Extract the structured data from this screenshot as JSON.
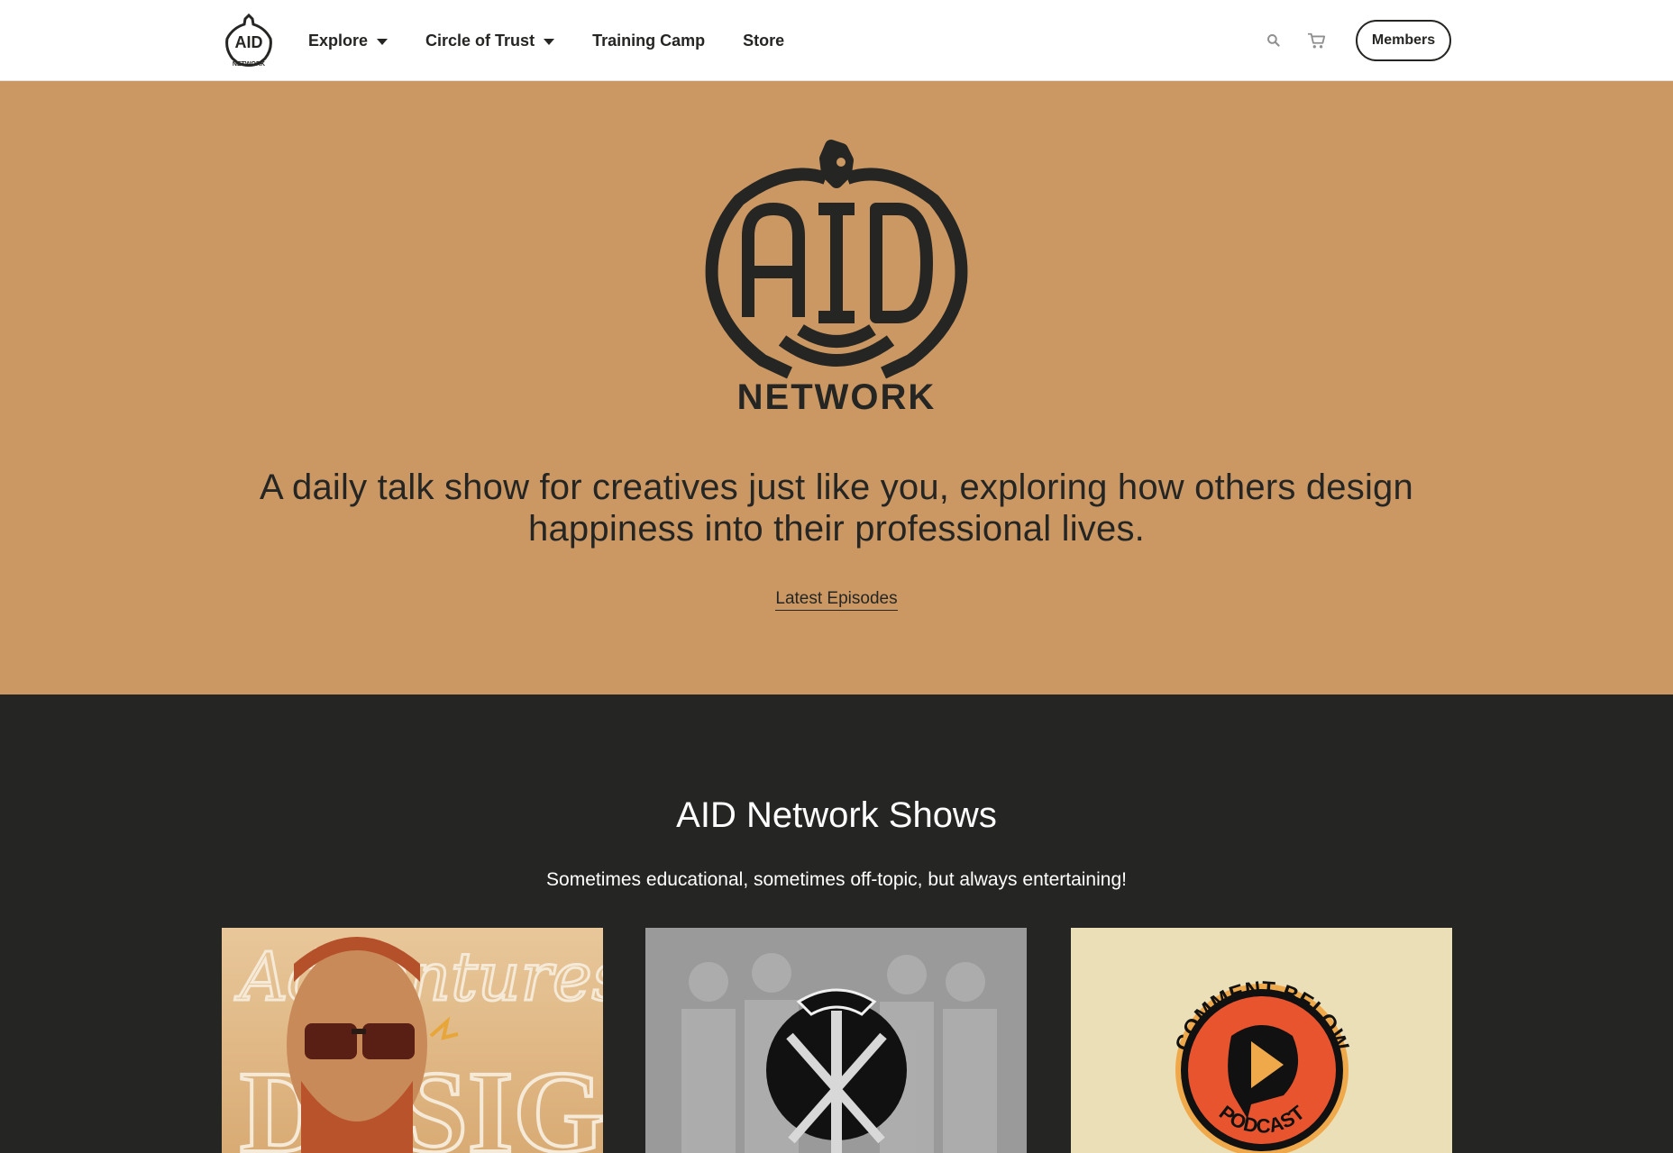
{
  "nav": {
    "logo_text": "AID NETWORK",
    "links": [
      {
        "label": "Explore",
        "has_dropdown": true
      },
      {
        "label": "Circle of Trust",
        "has_dropdown": true
      },
      {
        "label": "Training Camp",
        "has_dropdown": false
      },
      {
        "label": "Store",
        "has_dropdown": false
      }
    ],
    "icons": [
      "search-icon",
      "cart-icon"
    ],
    "members_label": "Members"
  },
  "hero": {
    "logo_text": "AID NETWORK",
    "tagline": "A daily talk show for creatives just like you, exploring how others design happiness into their professional lives.",
    "cta_label": "Latest Episodes",
    "background": "#cb9864"
  },
  "shows": {
    "title": "AID Network Shows",
    "subtitle": "Sometimes educational, sometimes off-topic, but always entertaining!",
    "cards": [
      {
        "art_text": "Adventures in Design"
      },
      {
        "art_text": ""
      },
      {
        "art_text": "COMMENT BELOW PODCAST"
      }
    ],
    "background": "#252623"
  },
  "colors": {
    "dark": "#252623",
    "tan": "#cb9864",
    "accent_orange": "#e8542e"
  }
}
